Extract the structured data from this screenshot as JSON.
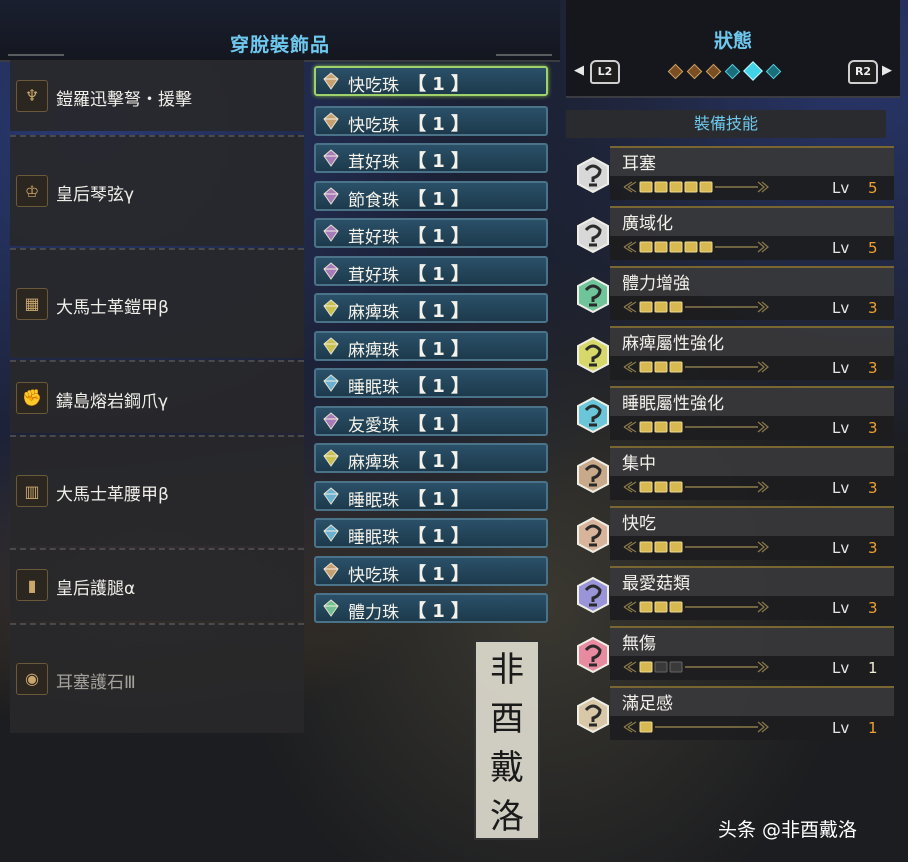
{
  "left_panel": {
    "title": "穿脫裝飾品",
    "equipment": [
      {
        "name": "鎧羅迅擊弩・援擊",
        "icon": "bowgun-icon",
        "dim": false,
        "decorations": [
          {
            "name": "快吃珠",
            "slot": "【 1 】",
            "selected": true
          },
          {
            "name": "快吃珠",
            "slot": "【 1 】"
          }
        ]
      },
      {
        "name": "皇后琴弦γ",
        "icon": "helmet-icon",
        "dim": false,
        "decorations": [
          {
            "name": "茸好珠",
            "slot": "【 1 】"
          },
          {
            "name": "節食珠",
            "slot": "【 1 】"
          },
          {
            "name": "茸好珠",
            "slot": "【 1 】"
          }
        ]
      },
      {
        "name": "大馬士革鎧甲β",
        "icon": "chest-armor-icon",
        "dim": false,
        "decorations": [
          {
            "name": "茸好珠",
            "slot": "【 1 】"
          },
          {
            "name": "麻痺珠",
            "slot": "【 1 】"
          },
          {
            "name": "麻痺珠",
            "slot": "【 1 】"
          }
        ]
      },
      {
        "name": "鑄島熔岩鋼爪γ",
        "icon": "gauntlet-icon",
        "dim": false,
        "decorations": [
          {
            "name": "睡眠珠",
            "slot": "【 1 】"
          },
          {
            "name": "友愛珠",
            "slot": "【 1 】"
          }
        ]
      },
      {
        "name": "大馬士革腰甲β",
        "icon": "waist-armor-icon",
        "dim": false,
        "decorations": [
          {
            "name": "麻痺珠",
            "slot": "【 1 】"
          },
          {
            "name": "睡眠珠",
            "slot": "【 1 】"
          },
          {
            "name": "睡眠珠",
            "slot": "【 1 】"
          }
        ]
      },
      {
        "name": "皇后護腿α",
        "icon": "leg-armor-icon",
        "dim": false,
        "decorations": [
          {
            "name": "快吃珠",
            "slot": "【 1 】"
          },
          {
            "name": "體力珠",
            "slot": "【 1 】"
          }
        ]
      },
      {
        "name": "耳塞護石Ⅲ",
        "icon": "charm-icon",
        "dim": true,
        "decorations": []
      }
    ]
  },
  "right_panel": {
    "title": "狀態",
    "l_button": "L2",
    "r_button": "R2",
    "page_dots": [
      "orange",
      "orange",
      "orange",
      "cyan",
      "active",
      "cyan"
    ],
    "section_title": "裝備技能",
    "level_label": "Lv",
    "skills": [
      {
        "name": "耳塞",
        "level": 5,
        "max": 5,
        "gem_color": "#d8d8d8"
      },
      {
        "name": "廣域化",
        "level": 5,
        "max": 5,
        "gem_color": "#d8d8d8"
      },
      {
        "name": "體力增強",
        "level": 3,
        "max": 3,
        "gem_color": "#6fc49a"
      },
      {
        "name": "麻痺屬性強化",
        "level": 3,
        "max": 3,
        "gem_color": "#d6d86a"
      },
      {
        "name": "睡眠屬性強化",
        "level": 3,
        "max": 3,
        "gem_color": "#6ac6d8"
      },
      {
        "name": "集中",
        "level": 3,
        "max": 3,
        "gem_color": "#c8aa8a"
      },
      {
        "name": "快吃",
        "level": 3,
        "max": 3,
        "gem_color": "#d8b49a"
      },
      {
        "name": "最愛菇類",
        "level": 3,
        "max": 3,
        "gem_color": "#9a94d8"
      },
      {
        "name": "無傷",
        "level": 1,
        "max": 3,
        "gem_color": "#e88aa0"
      },
      {
        "name": "滿足感",
        "level": 1,
        "max": 1,
        "gem_color": "#d8c8a8"
      }
    ]
  },
  "watermark": [
    "非",
    "酉",
    "戴",
    "洛"
  ],
  "credit": "头条 @非酉戴洛"
}
